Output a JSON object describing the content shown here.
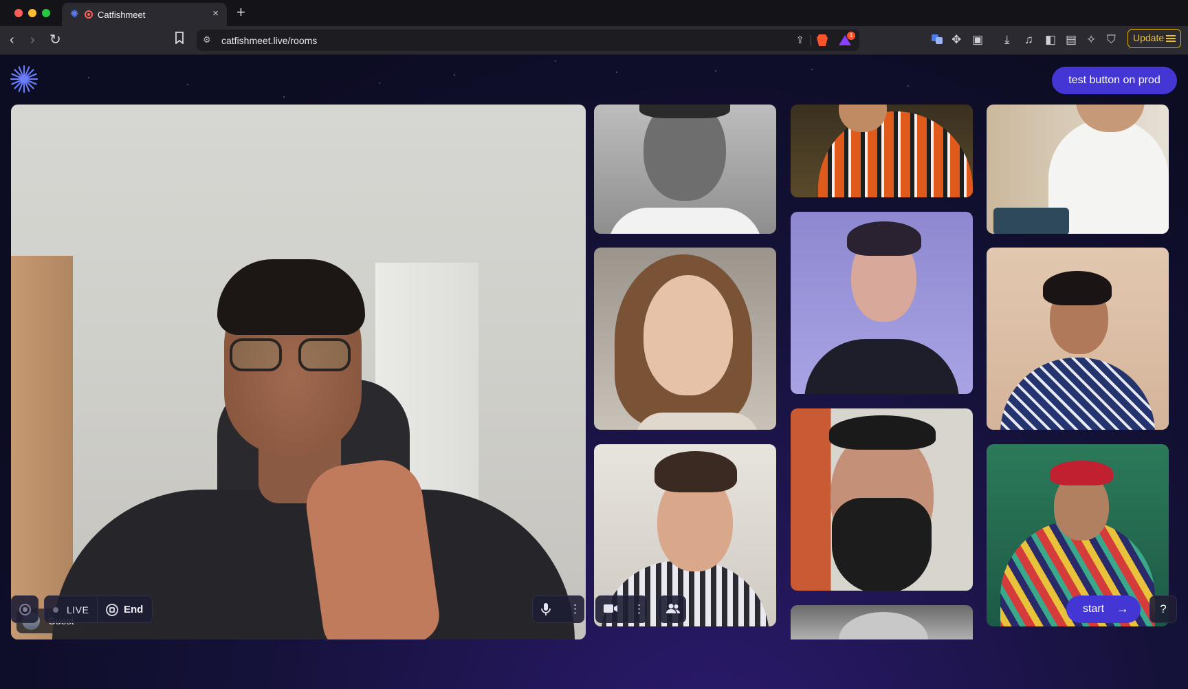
{
  "browser": {
    "tab_title": "Catfishmeet",
    "tab_close": "×",
    "new_tab": "+",
    "url": "catfishmeet.live/rooms",
    "update_label": "Update",
    "notification_count": "1"
  },
  "header": {
    "test_button": "test button on prod"
  },
  "main_video": {
    "participant_name": "Guest"
  },
  "controls": {
    "live_label": "LIVE",
    "end_label": "End",
    "start_label": "start",
    "help_label": "?"
  },
  "icons": {
    "back": "‹",
    "forward": "›",
    "reload": "↻",
    "bookmark": "⌑",
    "share": "⇪",
    "mic": "🎤",
    "more": "⋮",
    "camera": "■",
    "people": "👥",
    "arrow": "→"
  },
  "colors": {
    "accent": "#4436d4",
    "update_border": "#e8b400",
    "page_bg": "#15123a"
  }
}
